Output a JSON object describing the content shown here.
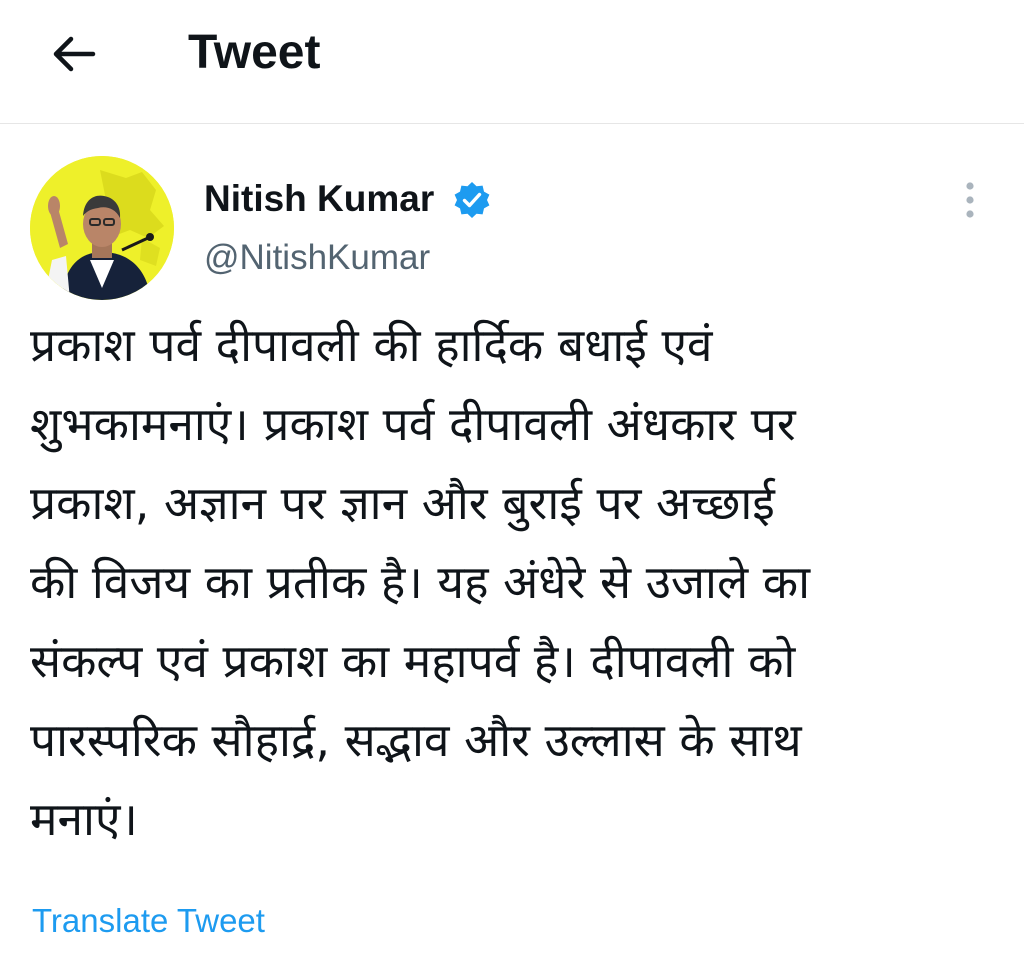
{
  "header": {
    "back_icon": "arrow-left-icon",
    "title": "Tweet"
  },
  "tweet": {
    "author": {
      "name": "Nitish Kumar",
      "handle": "@NitishKumar",
      "verified": true,
      "verified_icon": "verified-badge-icon",
      "avatar_background": "#eef02a"
    },
    "more_icon": "more-vertical-icon",
    "text_lines": [
      "प्रकाश पर्व दीपावली की हार्दिक बधाई एवं",
      "शुभकामनाएं। प्रकाश पर्व दीपावली अंधकार पर",
      "प्रकाश, अज्ञान पर ज्ञान और बुराई पर अच्छाई",
      "की विजय का प्रतीक है। यह अंधेरे से उजाले का",
      "संकल्प एवं प्रकाश का महापर्व है। दीपावली को",
      "पारस्परिक सौहार्द्र, सद्भाव और उल्लास के साथ",
      "मनाएं।"
    ],
    "translate_label": "Translate Tweet"
  },
  "colors": {
    "text_primary": "#0f1419",
    "text_secondary": "#536471",
    "link": "#1d9bf0",
    "verified": "#1d9bf0",
    "divider": "#e6e6e6"
  }
}
